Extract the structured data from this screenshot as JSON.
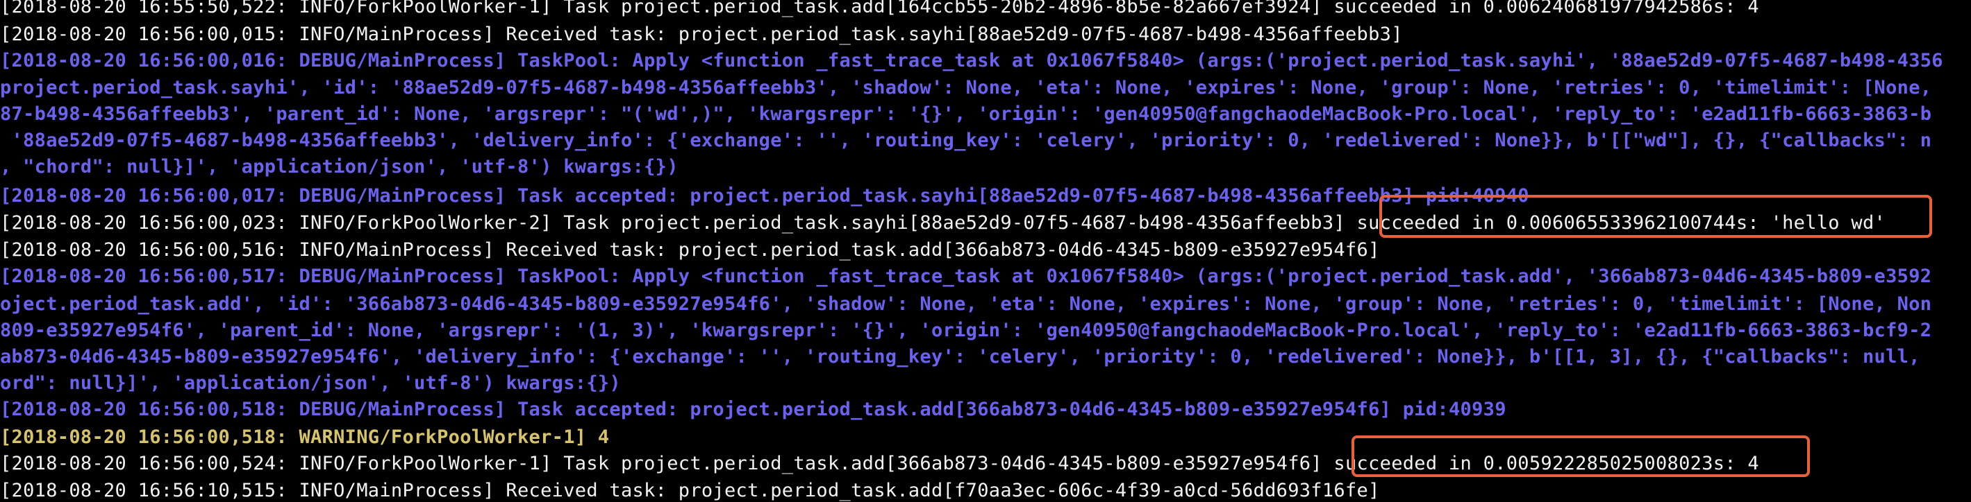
{
  "colors": {
    "background": "#000000",
    "info_text": "#f2f2f2",
    "debug_text": "#6b63f0",
    "warning_text": "#d6c36a",
    "highlight_border": "#e8613c"
  },
  "terminal": {
    "lines": [
      {
        "level": "info",
        "text": "[2018-08-20 16:55:50,522: INFO/ForkPoolWorker-1] Task project.period_task.add[164ccb55-20b2-4896-8b5e-82a667ef3924] succeeded in 0.006240681977942586s: 4"
      },
      {
        "level": "info",
        "text": "[2018-08-20 16:56:00,015: INFO/MainProcess] Received task: project.period_task.sayhi[88ae52d9-07f5-4687-b498-4356affeebb3]"
      },
      {
        "level": "debug",
        "text": "[2018-08-20 16:56:00,016: DEBUG/MainProcess] TaskPool: Apply <function _fast_trace_task at 0x1067f5840> (args:('project.period_task.sayhi', '88ae52d9-07f5-4687-b498-4356"
      },
      {
        "level": "debug",
        "text": "project.period_task.sayhi', 'id': '88ae52d9-07f5-4687-b498-4356affeebb3', 'shadow': None, 'eta': None, 'expires': None, 'group': None, 'retries': 0, 'timelimit': [None,"
      },
      {
        "level": "debug",
        "text": "87-b498-4356affeebb3', 'parent_id': None, 'argsrepr': \"('wd',)\", 'kwargsrepr': '{}', 'origin': 'gen40950@fangchaodeMacBook-Pro.local', 'reply_to': 'e2ad11fb-6663-3863-b"
      },
      {
        "level": "debug",
        "text": " '88ae52d9-07f5-4687-b498-4356affeebb3', 'delivery_info': {'exchange': '', 'routing_key': 'celery', 'priority': 0, 'redelivered': None}}, b'[[\"wd\"], {}, {\"callbacks\": n"
      },
      {
        "level": "debug",
        "text": ", \"chord\": null}]', 'application/json', 'utf-8') kwargs:{})"
      },
      {
        "level": "debug",
        "text": "[2018-08-20 16:56:00,017: DEBUG/MainProcess] Task accepted: project.period_task.sayhi[88ae52d9-07f5-4687-b498-4356affeebb3] pid:40940"
      },
      {
        "level": "info",
        "text": "[2018-08-20 16:56:00,023: INFO/ForkPoolWorker-2] Task project.period_task.sayhi[88ae52d9-07f5-4687-b498-4356affeebb3] succeeded in 0.006065533962100744s: 'hello wd'"
      },
      {
        "level": "info",
        "text": "[2018-08-20 16:56:00,516: INFO/MainProcess] Received task: project.period_task.add[366ab873-04d6-4345-b809-e35927e954f6]"
      },
      {
        "level": "debug",
        "text": "[2018-08-20 16:56:00,517: DEBUG/MainProcess] TaskPool: Apply <function _fast_trace_task at 0x1067f5840> (args:('project.period_task.add', '366ab873-04d6-4345-b809-e3592"
      },
      {
        "level": "debug",
        "text": "oject.period_task.add', 'id': '366ab873-04d6-4345-b809-e35927e954f6', 'shadow': None, 'eta': None, 'expires': None, 'group': None, 'retries': 0, 'timelimit': [None, Non"
      },
      {
        "level": "debug",
        "text": "809-e35927e954f6', 'parent_id': None, 'argsrepr': '(1, 3)', 'kwargsrepr': '{}', 'origin': 'gen40950@fangchaodeMacBook-Pro.local', 'reply_to': 'e2ad11fb-6663-3863-bcf9-2"
      },
      {
        "level": "debug",
        "text": "ab873-04d6-4345-b809-e35927e954f6', 'delivery_info': {'exchange': '', 'routing_key': 'celery', 'priority': 0, 'redelivered': None}}, b'[[1, 3], {}, {\"callbacks\": null,"
      },
      {
        "level": "debug",
        "text": "ord\": null}]', 'application/json', 'utf-8') kwargs:{})"
      },
      {
        "level": "debug",
        "text": "[2018-08-20 16:56:00,518: DEBUG/MainProcess] Task accepted: project.period_task.add[366ab873-04d6-4345-b809-e35927e954f6] pid:40939"
      },
      {
        "level": "warning",
        "text": "[2018-08-20 16:56:00,518: WARNING/ForkPoolWorker-1] 4"
      },
      {
        "level": "info",
        "text": "[2018-08-20 16:56:00,524: INFO/ForkPoolWorker-1] Task project.period_task.add[366ab873-04d6-4345-b809-e35927e954f6] succeeded in 0.005922285025008023s: 4"
      },
      {
        "level": "info",
        "text": "[2018-08-20 16:56:10,515: INFO/MainProcess] Received task: project.period_task.add[f70aa3ec-606c-4f39-a0cd-56dd693f16fe]"
      }
    ]
  },
  "highlights": [
    {
      "label": "succeeded in 0.006065533962100744s: 'hello wd'"
    },
    {
      "label": "succeeded in 0.005922285025008023s: 4"
    }
  ]
}
